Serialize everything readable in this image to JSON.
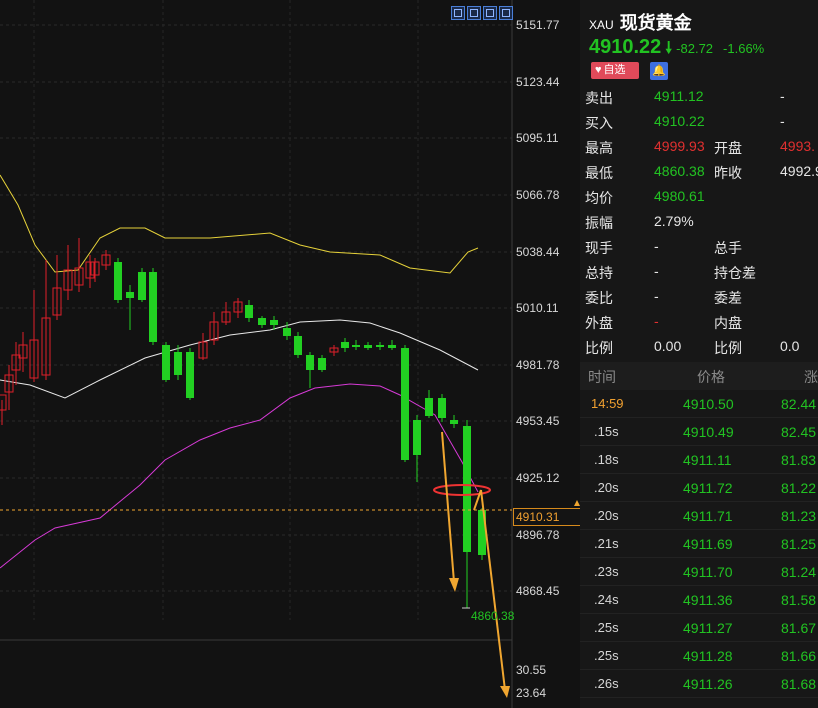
{
  "chart": {
    "y_ticks": [
      "5151.77",
      "5123.44",
      "5095.11",
      "5066.78",
      "5038.44",
      "5010.11",
      "4981.78",
      "4953.45",
      "4925.12",
      "4896.78",
      "4868.45",
      "30.55",
      "23.64"
    ],
    "current_price_tag": "4910.31",
    "low_label": "4860.38",
    "colors": {
      "up": "#e0202a",
      "down": "#22d022",
      "ma_upper": "#e6d23a",
      "ma_mid": "#e8e8e8",
      "ma_lower": "#d63ad6",
      "arrow": "#f0a630",
      "ring": "#ee3333"
    }
  },
  "toolbar": {
    "icons": [
      "crosshair-icon",
      "move-icon",
      "chart-mode-icon",
      "draw-line-icon"
    ]
  },
  "quote": {
    "code": "XAU",
    "name": "现货黄金",
    "price": "4910.22",
    "change": "-82.72",
    "change_pct": "-1.66%",
    "fav_label": "自选",
    "rows": [
      {
        "l1": "卖出",
        "v1": "4911.12",
        "v1c": "#22c322",
        "l2": "",
        "v2": "-",
        "v2c": "#e6e6e6"
      },
      {
        "l1": "买入",
        "v1": "4910.22",
        "v1c": "#22c322",
        "l2": "",
        "v2": "-",
        "v2c": "#e6e6e6"
      },
      {
        "l1": "最高",
        "v1": "4999.93",
        "v1c": "#e03030",
        "l2": "开盘",
        "v2": "4993.",
        "v2c": "#e03030"
      },
      {
        "l1": "最低",
        "v1": "4860.38",
        "v1c": "#22c322",
        "l2": "昨收",
        "v2": "4992.9",
        "v2c": "#e6e6e6"
      },
      {
        "l1": "均价",
        "v1": "4980.61",
        "v1c": "#22c322",
        "l2": "",
        "v2": "",
        "v2c": "#e6e6e6"
      },
      {
        "l1": "振幅",
        "v1": "2.79%",
        "v1c": "#e6e6e6",
        "l2": "",
        "v2": "",
        "v2c": "#e6e6e6"
      },
      {
        "l1": "现手",
        "v1": "-",
        "v1c": "#e6e6e6",
        "l2": "总手",
        "v2": "",
        "v2c": "#e6e6e6"
      },
      {
        "l1": "总持",
        "v1": "-",
        "v1c": "#e6e6e6",
        "l2": "持仓差",
        "v2": "",
        "v2c": "#e6e6e6"
      },
      {
        "l1": "委比",
        "v1": "-",
        "v1c": "#e6e6e6",
        "l2": "委差",
        "v2": "",
        "v2c": "#e6e6e6"
      },
      {
        "l1": "外盘",
        "v1": "-",
        "v1c": "#e03030",
        "l2": "内盘",
        "v2": "",
        "v2c": "#e6e6e6"
      },
      {
        "l1": "比例",
        "v1": "0.00",
        "v1c": "#e6e6e6",
        "l2": "比例",
        "v2": "0.0",
        "v2c": "#e6e6e6"
      }
    ]
  },
  "ticks": {
    "headers": [
      "时间",
      "价格",
      "涨"
    ],
    "rows": [
      {
        "time": "14:59",
        "price": "4910.50",
        "chg": "82.44",
        "tc": "#f0a030"
      },
      {
        "time": ".15s",
        "price": "4910.49",
        "chg": "82.45",
        "tc": "#d6d6d6"
      },
      {
        "time": ".18s",
        "price": "4911.11",
        "chg": "81.83",
        "tc": "#d6d6d6"
      },
      {
        "time": ".20s",
        "price": "4911.72",
        "chg": "81.22",
        "tc": "#d6d6d6"
      },
      {
        "time": ".20s",
        "price": "4911.71",
        "chg": "81.23",
        "tc": "#d6d6d6"
      },
      {
        "time": ".21s",
        "price": "4911.69",
        "chg": "81.25",
        "tc": "#d6d6d6"
      },
      {
        "time": ".23s",
        "price": "4911.70",
        "chg": "81.24",
        "tc": "#d6d6d6"
      },
      {
        "time": ".24s",
        "price": "4911.36",
        "chg": "81.58",
        "tc": "#d6d6d6"
      },
      {
        "time": ".25s",
        "price": "4911.27",
        "chg": "81.67",
        "tc": "#d6d6d6"
      },
      {
        "time": ".25s",
        "price": "4911.28",
        "chg": "81.66",
        "tc": "#d6d6d6"
      },
      {
        "time": ".26s",
        "price": "4911.26",
        "chg": "81.68",
        "tc": "#d6d6d6"
      }
    ]
  }
}
